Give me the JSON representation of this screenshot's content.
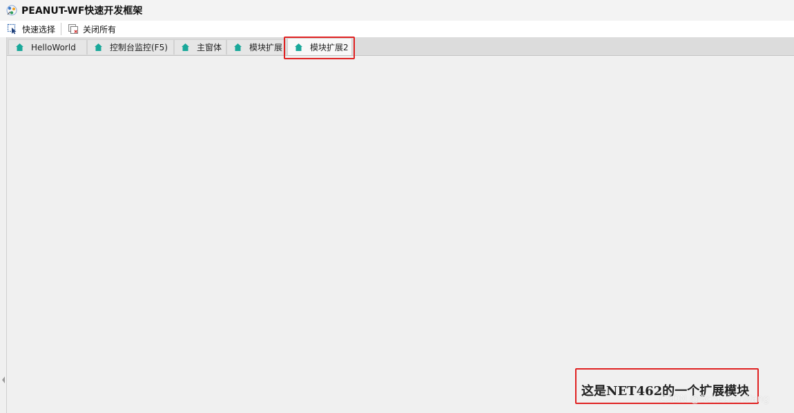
{
  "window": {
    "title": "PEANUT-WF快速开发框架"
  },
  "toolbar": {
    "quick_select_label": "快速选择",
    "close_all_label": "关闭所有"
  },
  "tabs": [
    {
      "label": "HelloWorld",
      "icon": "home-icon",
      "active": false
    },
    {
      "label": "控制台监控(F5)",
      "icon": "home-icon",
      "active": false
    },
    {
      "label": "主窗体",
      "icon": "home-icon",
      "active": false
    },
    {
      "label": "模块扩展",
      "icon": "home-icon",
      "active": false
    },
    {
      "label": "模块扩展2",
      "icon": "home-icon",
      "active": true
    }
  ],
  "content": {
    "module_text": "这是NET462的一个扩展模块"
  },
  "watermark": "CSDN @SchecterWang",
  "colors": {
    "tab_icon": "#1aa89a",
    "highlight": "#e02020",
    "background": "#f0f0f0"
  }
}
